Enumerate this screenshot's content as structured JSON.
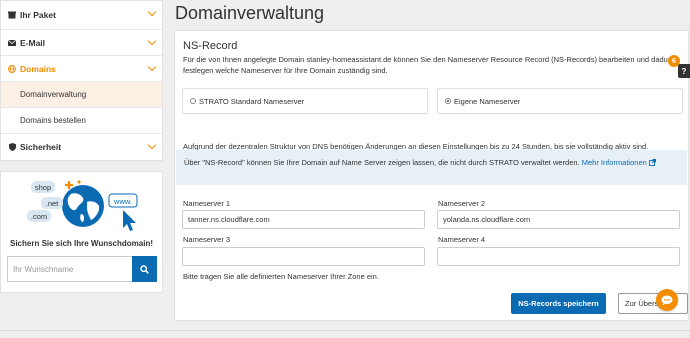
{
  "sidebar": {
    "items": [
      {
        "label": "Ihr Paket",
        "icon": "package-icon"
      },
      {
        "label": "E-Mail",
        "icon": "envelope-icon"
      },
      {
        "label": "Domains",
        "icon": "globe-icon"
      },
      {
        "label": "Sicherheit",
        "icon": "shield-icon"
      }
    ],
    "domains_sub": [
      {
        "label": "Domainverwaltung"
      },
      {
        "label": "Domains bestellen"
      }
    ],
    "promo": {
      "tags": [
        "shop",
        ".net",
        ".com",
        "www."
      ],
      "title": "Sichern Sie sich Ihre Wunschdomain!",
      "input_placeholder": "Ihr Wunschname",
      "search_icon": "search-icon"
    }
  },
  "main": {
    "title": "Domainverwaltung",
    "card": {
      "title": "NS-Record",
      "description": "Für die von Ihnen angelegte Domain stanley-homeassistant.de können Sie den Nameserver Resource Record (NS-Records) bearbeiten und dadurch festlegen welche Nameserver für Ihre Domain zuständig sind.",
      "options": [
        {
          "label": "STRATO Standard Nameserver",
          "selected": false
        },
        {
          "label": "Eigene Nameserver",
          "selected": true
        }
      ],
      "dns_note": "Aufgrund der dezentralen Struktur von DNS benötigen Änderungen an diesen Einstellungen bis zu 24 Stunden, bis sie vollständig aktiv sind.",
      "info_text": "Über \"NS-Record\" können Sie Ihre Domain auf Name Server zeigen lassen, die nicht durch STRATO verwaltet werden.",
      "info_link": "Mehr Informationen",
      "nameservers": [
        {
          "label": "Nameserver 1",
          "value": "tanner.ns.cloudflare.com"
        },
        {
          "label": "Nameserver 2",
          "value": "yolanda.ns.cloudflare.com"
        },
        {
          "label": "Nameserver 3",
          "value": ""
        },
        {
          "label": "Nameserver 4",
          "value": ""
        }
      ],
      "hint": "Bitte tragen Sie alle definierten Nameserver Ihrer Zone ein.",
      "save_label": "NS-Records speichern",
      "back_label": "Zur Übersicht"
    }
  },
  "help": {
    "label": "?",
    "badge": "6"
  },
  "colors": {
    "accent": "#f28c00",
    "primary": "#0a6bb3",
    "info_bg": "#e6f0f6",
    "selected_bg": "#fcf0e4"
  }
}
